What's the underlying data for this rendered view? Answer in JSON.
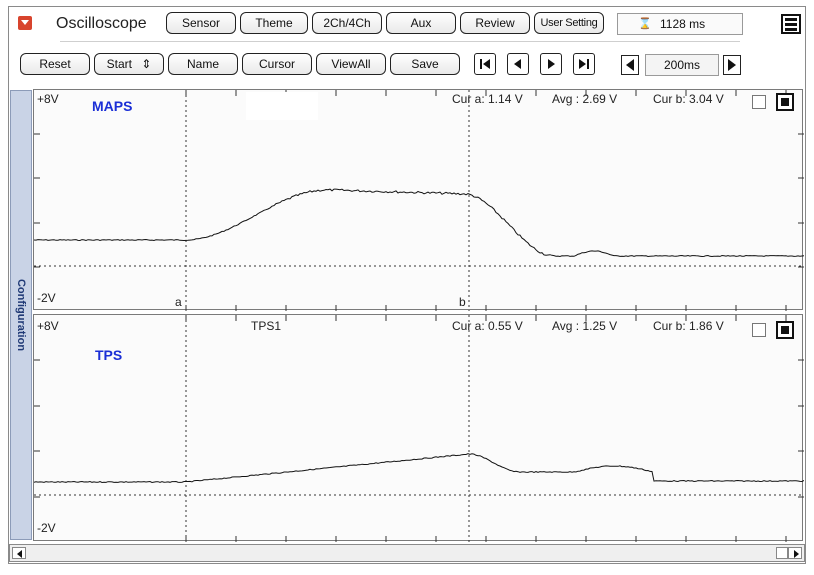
{
  "app": {
    "title": "Oscilloscope"
  },
  "toolbar_top": {
    "sensor": "Sensor",
    "theme": "Theme",
    "channels": "2Ch/4Ch",
    "aux": "Aux",
    "review": "Review",
    "user_setting": "User Setting",
    "time_value": "1128 ms",
    "time_icon": "hourglass-icon"
  },
  "toolbar_bottom": {
    "reset": "Reset",
    "start": "Start",
    "start_arrows": "⇕",
    "name": "Name",
    "cursor": "Cursor",
    "view_all": "ViewAll",
    "save": "Save",
    "zoom": "200ms"
  },
  "side_tab": {
    "label": "Configuration"
  },
  "channels": [
    {
      "name": "MAPS",
      "tag": "",
      "y_max": "+8V",
      "y_min": "-2V",
      "cur_a": "Cur a: 1.14 V",
      "avg": "Avg : 2.69 V",
      "cur_b": "Cur b: 3.04 V",
      "marker_a": "a",
      "marker_b": "b",
      "color": "#1b2fd6"
    },
    {
      "name": "TPS",
      "tag": "TPS1",
      "y_max": "+8V",
      "y_min": "-2V",
      "cur_a": "Cur a: 0.55 V",
      "avg": "Avg : 1.25 V",
      "cur_b": "Cur b: 1.86 V",
      "color": "#1b2fd6"
    }
  ],
  "colors": {
    "trace": "#111111",
    "grid": "#333333",
    "side_tab_bg": "#c9d3e6"
  }
}
